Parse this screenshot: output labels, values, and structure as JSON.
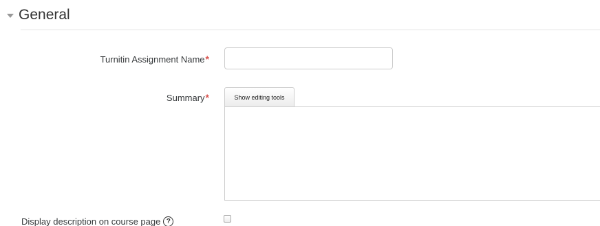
{
  "section": {
    "title": "General"
  },
  "fields": {
    "name": {
      "label": "Turnitin Assignment Name",
      "required_marker": "*",
      "value": ""
    },
    "summary": {
      "label": "Summary",
      "required_marker": "*",
      "editor_tab_label": "Show editing tools",
      "value": ""
    },
    "display_description": {
      "label": "Display description on course page",
      "help_glyph": "?",
      "checked": false
    }
  },
  "colors": {
    "required": "#d9534f",
    "border": "#cccccc",
    "text": "#373a3c"
  },
  "icons": {
    "section_toggle": "caret-down-icon",
    "help": "help-icon"
  }
}
